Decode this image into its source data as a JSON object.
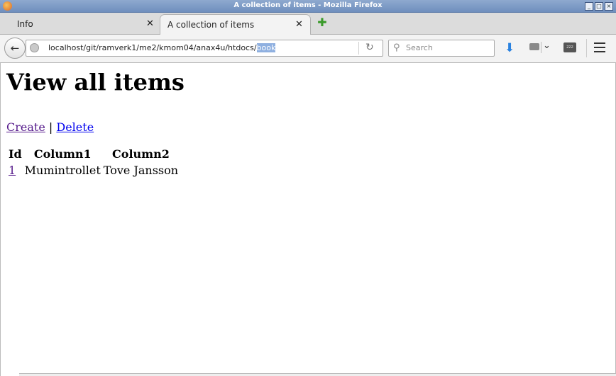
{
  "window": {
    "title": "A collection of items - Mozilla Firefox"
  },
  "tabs": [
    {
      "label": "Info",
      "active": false
    },
    {
      "label": "A collection of items",
      "active": true
    }
  ],
  "navbar": {
    "url_prefix": "localhost/git/ramverk1/me2/kmom04/anax4u/htdocs/",
    "url_selected": "book",
    "search_placeholder": "Search"
  },
  "page": {
    "heading": "View all items",
    "links": {
      "create": "Create",
      "separator": "|",
      "delete": "Delete"
    },
    "table": {
      "headers": [
        "Id",
        "Column1",
        "Column2"
      ],
      "rows": [
        {
          "id": "1",
          "col1": "Mumintrollet",
          "col2": "Tove Jansson"
        }
      ]
    }
  },
  "colors": {
    "visited_link": "#551a8b",
    "link": "#0000ee",
    "titlebar": "#6f8fbe"
  }
}
